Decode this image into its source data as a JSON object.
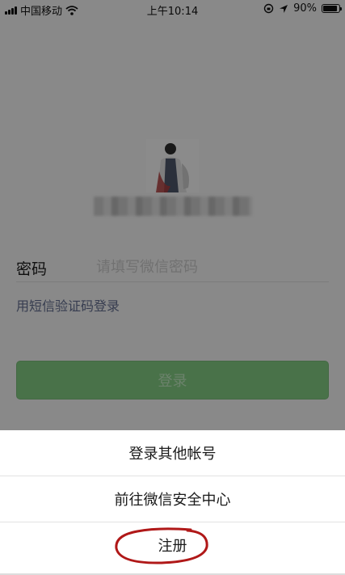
{
  "status_bar": {
    "carrier": "中国移动",
    "time": "上午10:14",
    "battery": "90%",
    "battery_level": 0.9
  },
  "profile": {
    "avatar_icon": "user-avatar-photo"
  },
  "login_form": {
    "password_label": "密码",
    "password_placeholder": "请填写微信密码",
    "sms_login_link": "用短信验证码登录",
    "login_button": "登录"
  },
  "action_sheet": {
    "items": [
      "登录其他帐号",
      "前往微信安全中心",
      "注册"
    ],
    "annotation_color": "#b01818"
  }
}
